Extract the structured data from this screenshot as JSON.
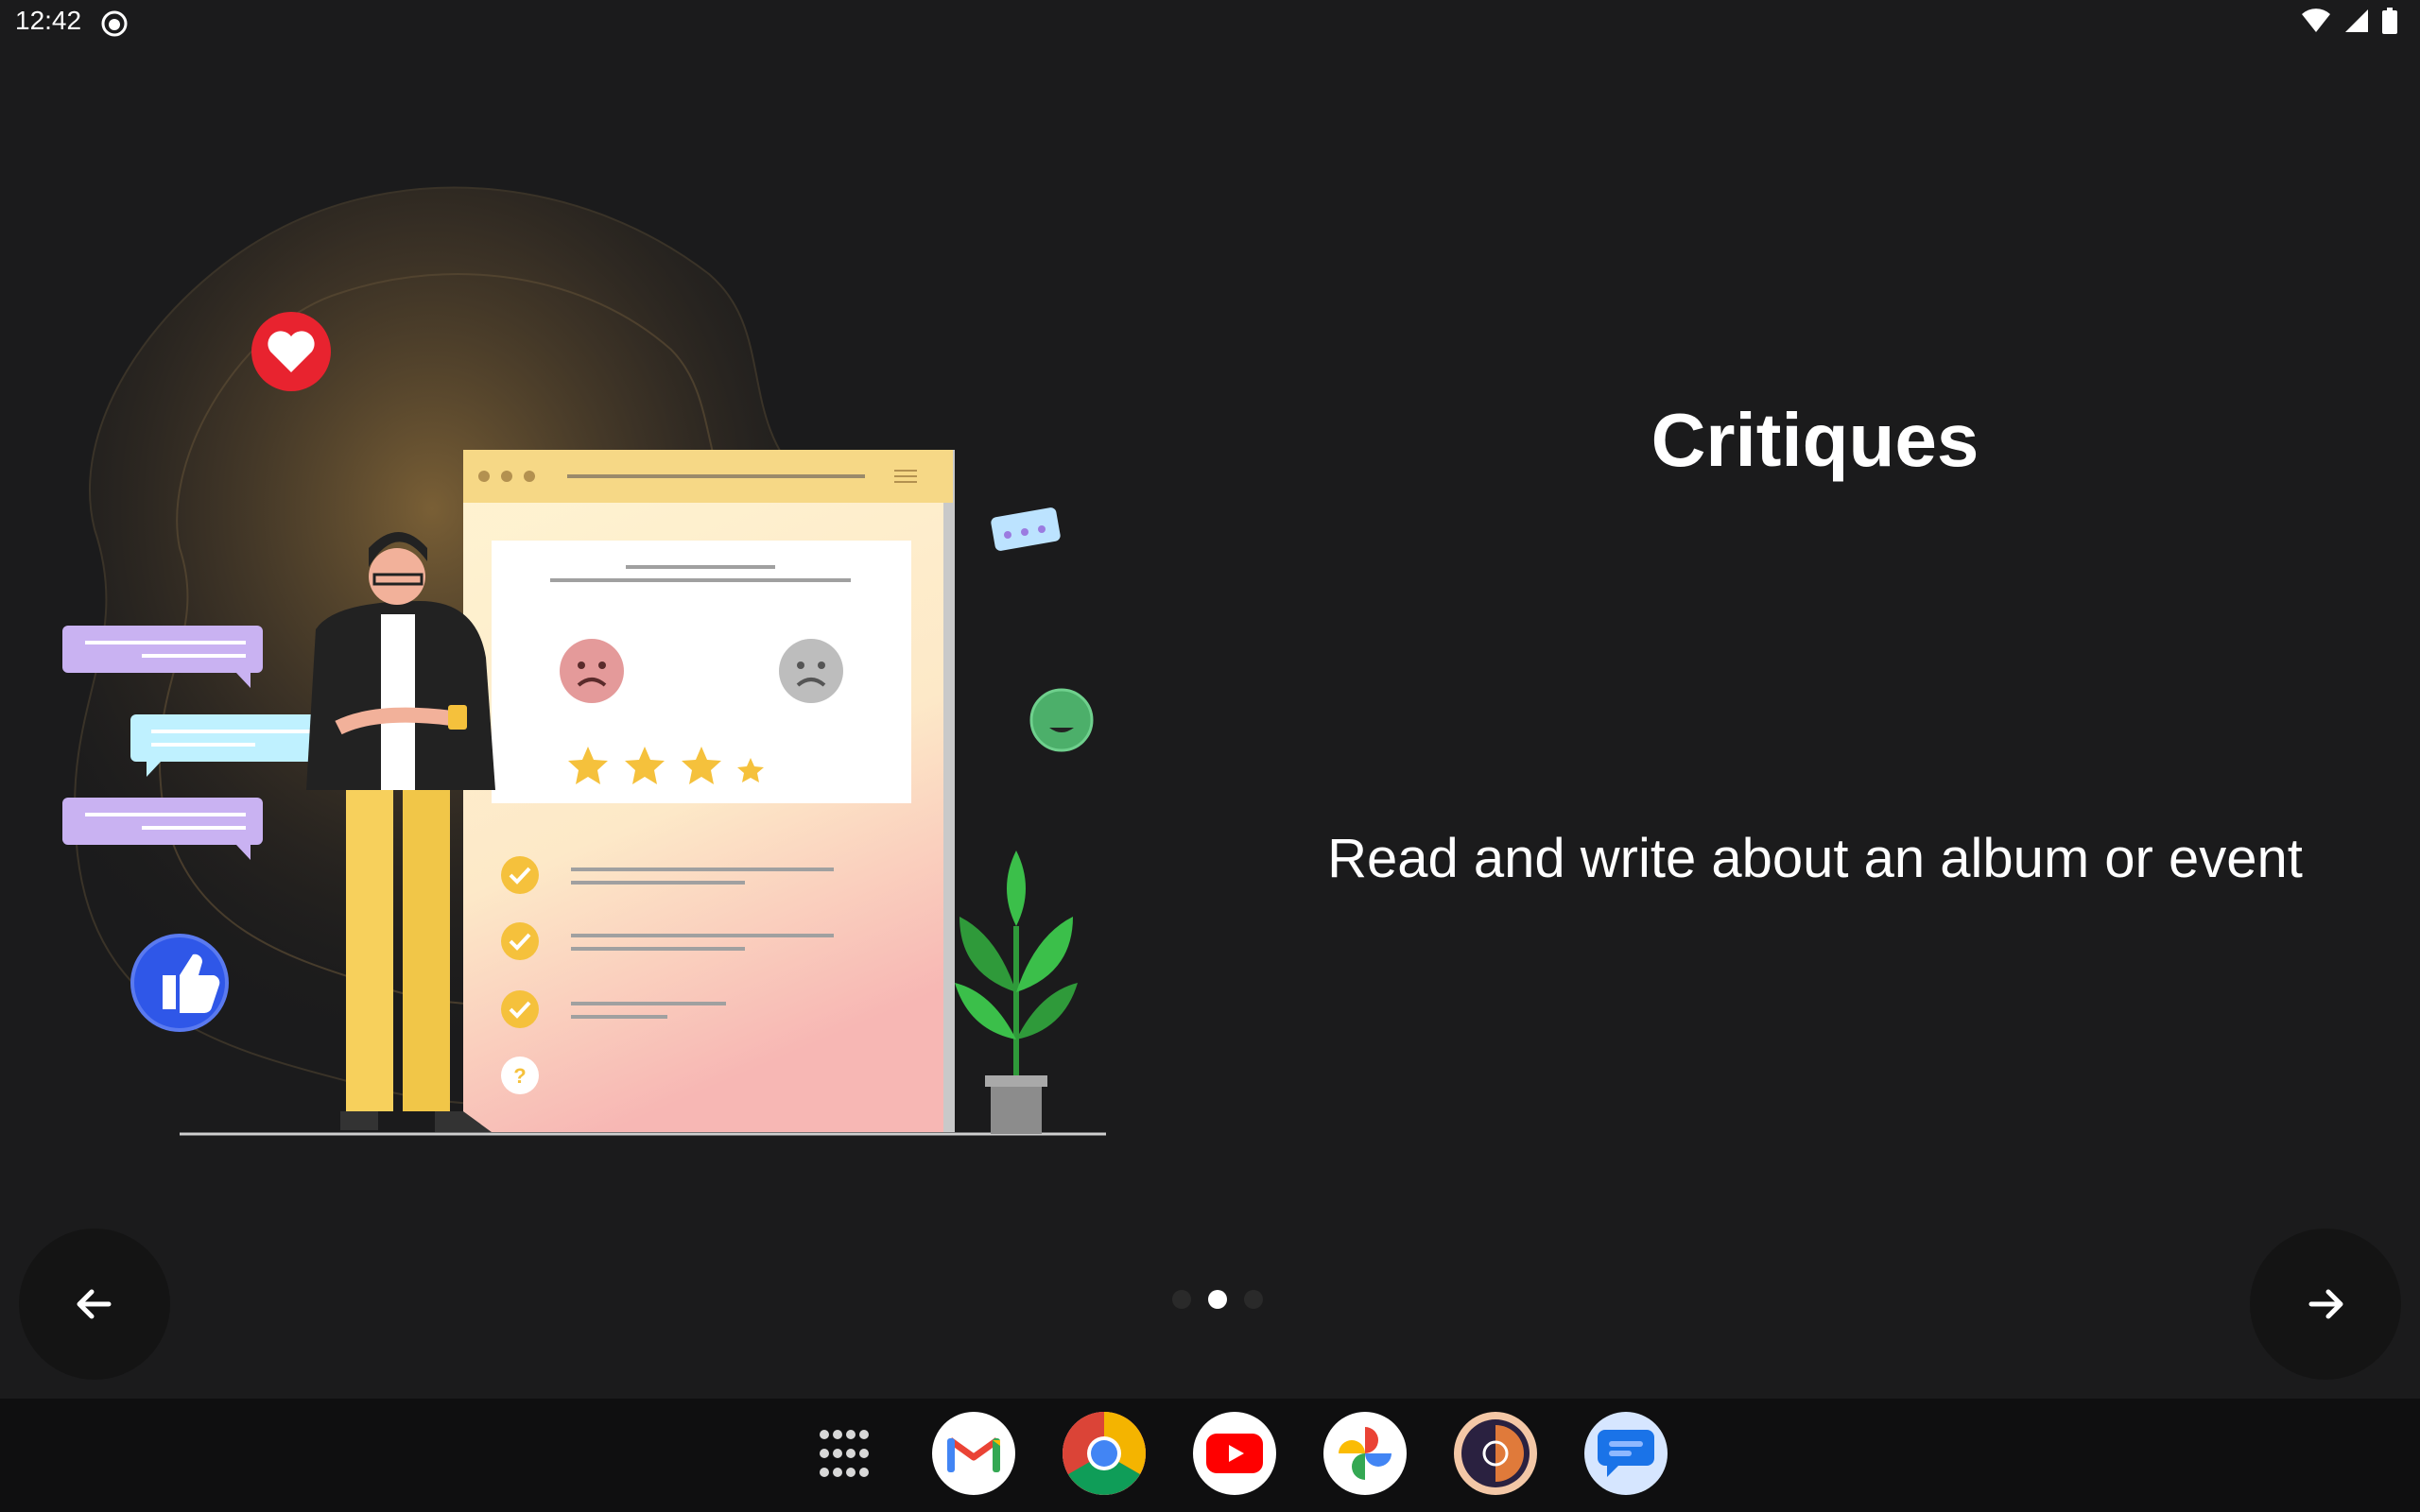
{
  "status_bar": {
    "time": "12:42",
    "icons": [
      "cat-notification-icon",
      "wifi-icon",
      "signal-icon",
      "battery-icon"
    ]
  },
  "slide": {
    "title": "Critiques",
    "description": "Read and write about an album or event",
    "page_count": 3,
    "current_page": 2
  },
  "navigation": {
    "prev_icon": "arrow-left-icon",
    "next_icon": "arrow-right-icon"
  },
  "taskbar": {
    "apps": [
      "app-drawer",
      "Gmail",
      "Chrome",
      "YouTube",
      "Photos",
      "Podcast app",
      "Messages"
    ]
  },
  "colors": {
    "background": "#1b1b1c",
    "accent_yellow": "#f5c13c",
    "heart_red": "#e8232f",
    "like_blue": "#2f57e8"
  }
}
